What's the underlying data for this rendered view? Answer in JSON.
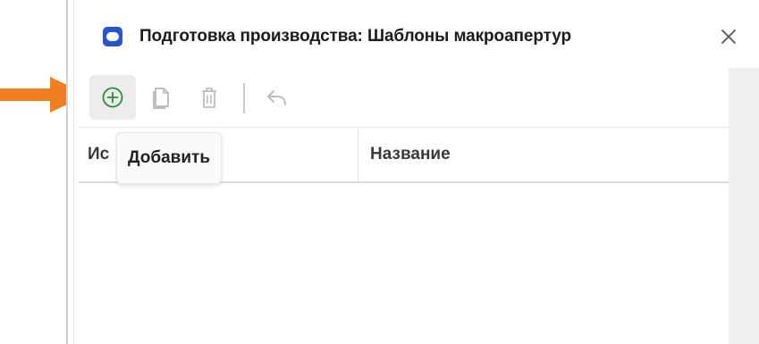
{
  "window": {
    "title": "Подготовка производства: Шаблоны макроапертур",
    "close_glyph": "✕",
    "icon": "window-app-icon"
  },
  "toolbar": {
    "buttons": [
      {
        "name": "add",
        "icon": "plus-circle-icon",
        "active": true
      },
      {
        "name": "copy",
        "icon": "copy-icon",
        "active": false
      },
      {
        "name": "delete",
        "icon": "trash-icon",
        "active": false
      },
      {
        "name": "undo",
        "icon": "undo-icon",
        "active": false
      }
    ],
    "add_tooltip": "Добавить"
  },
  "table": {
    "columns": [
      "Ис",
      "Название"
    ],
    "rows": []
  },
  "annotation": {
    "arrow_color": "#F07F21"
  },
  "colors": {
    "accent_green": "#2E8B3A",
    "icon_blue": "#2856C7",
    "disabled_icon": "#B5B5B5"
  }
}
